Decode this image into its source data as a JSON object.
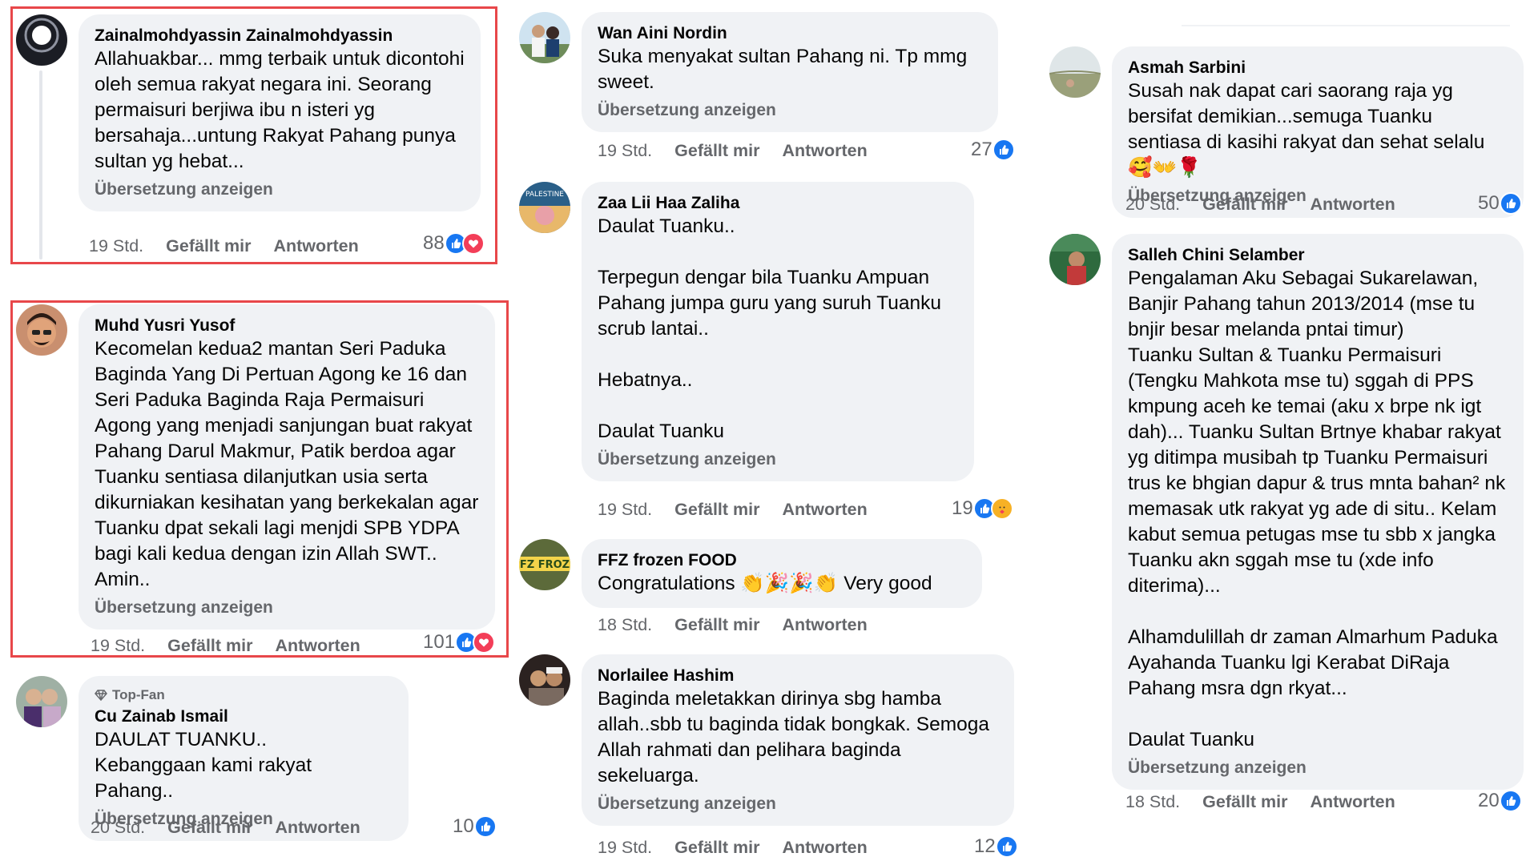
{
  "labels": {
    "translate": "Übersetzung anzeigen",
    "like": "Gefällt mir",
    "reply": "Antworten"
  },
  "colors": {
    "highlight": "#e8474a",
    "like": "#1877f2",
    "love": "#f33e58"
  },
  "comments": [
    {
      "author": "Zainalmohdyassin Zainalmohdyassin",
      "text": "Allahuakbar... mmg terbaik untuk dicontohi oleh semua rakyat negara ini. Seorang permaisuri berjiwa ibu n isteri yg bersahaja...untung Rakyat Pahang punya sultan yg hebat...",
      "time": "19 Std.",
      "reaction_count": "88",
      "reactions": [
        "like-icon",
        "love-icon"
      ],
      "highlighted": true
    },
    {
      "author": "Muhd Yusri Yusof",
      "text": "Kecomelan kedua2 mantan Seri Paduka Baginda Yang Di Pertuan Agong ke 16 dan Seri Paduka Baginda Raja Permaisuri Agong yang menjadi sanjungan buat rakyat Pahang Darul Makmur, Patik berdoa agar Tuanku sentiasa dilanjutkan usia serta dikurniakan kesihatan yang berkekalan agar Tuanku dpat sekali lagi menjdi SPB YDPA bagi kali kedua dengan izin Allah SWT.. Amin..",
      "time": "19 Std.",
      "reaction_count": "101",
      "reactions": [
        "like-icon",
        "love-icon"
      ],
      "highlighted": true
    },
    {
      "badge": "Top-Fan",
      "author": "Cu Zainab Ismail",
      "text": "DAULAT TUANKU..\nKebanggaan kami rakyat Pahang..",
      "time": "20 Std.",
      "reaction_count": "10",
      "reactions": [
        "like-icon"
      ]
    },
    {
      "author": "Wan Aini Nordin",
      "text": "Suka menyakat sultan Pahang ni. Tp mmg sweet.",
      "time": "19 Std.",
      "reaction_count": "27",
      "reactions": [
        "like-icon"
      ]
    },
    {
      "author": "Zaa Lii Haa Zaliha",
      "text": "Daulat Tuanku..\n\nTerpegun dengar bila Tuanku Ampuan Pahang jumpa guru yang suruh Tuanku scrub lantai..\n\nHebatnya..\n\nDaulat Tuanku",
      "time": "19 Std.",
      "reaction_count": "19",
      "reactions": [
        "like-icon",
        "care-icon"
      ],
      "avatar_text": "PALESTINE"
    },
    {
      "author": "FFZ frozen FOOD",
      "text": "Congratulations 👏🎉🎉👏 Very good",
      "time": "18 Std.",
      "avatar_text": "FZ FROZ"
    },
    {
      "author": "Norlailee Hashim",
      "text": "Baginda meletakkan dirinya sbg hamba allah..sbb tu baginda tidak bongkak. Semoga Allah rahmati dan pelihara baginda sekeluarga.",
      "time": "19 Std.",
      "reaction_count": "12",
      "reactions": [
        "like-icon"
      ]
    },
    {
      "author": "Asmah Sarbini",
      "text": "Susah nak dapat cari saorang raja yg bersifat demikian...semuga Tuanku sentiasa di kasihi rakyat dan sehat selalu 🥰👐🌹",
      "time": "20 Std.",
      "reaction_count": "50",
      "reactions": [
        "like-icon"
      ]
    },
    {
      "author": "Salleh Chini Selamber",
      "text": "Pengalaman Aku Sebagai Sukarelawan, Banjir Pahang tahun 2013/2014 (mse tu bnjir besar melanda pntai timur)\nTuanku Sultan & Tuanku Permaisuri (Tengku Mahkota mse tu) sggah di PPS kmpung aceh ke temai (aku x brpe nk igt dah)... Tuanku Sultan Brtnye khabar rakyat yg ditimpa musibah tp Tuanku Permaisuri trus ke bhgian dapur & trus mnta bahan² nk memasak utk rakyat yg ade di situ.. Kelam kabut semua petugas mse tu sbb x jangka Tuanku akn sggah mse tu (xde info diterima)...\n\nAlhamdulillah dr zaman Almarhum Paduka Ayahanda Tuanku lgi Kerabat DiRaja Pahang msra dgn rkyat...\n\nDaulat Tuanku",
      "time": "18 Std.",
      "reaction_count": "20",
      "reactions": [
        "like-icon"
      ]
    }
  ]
}
